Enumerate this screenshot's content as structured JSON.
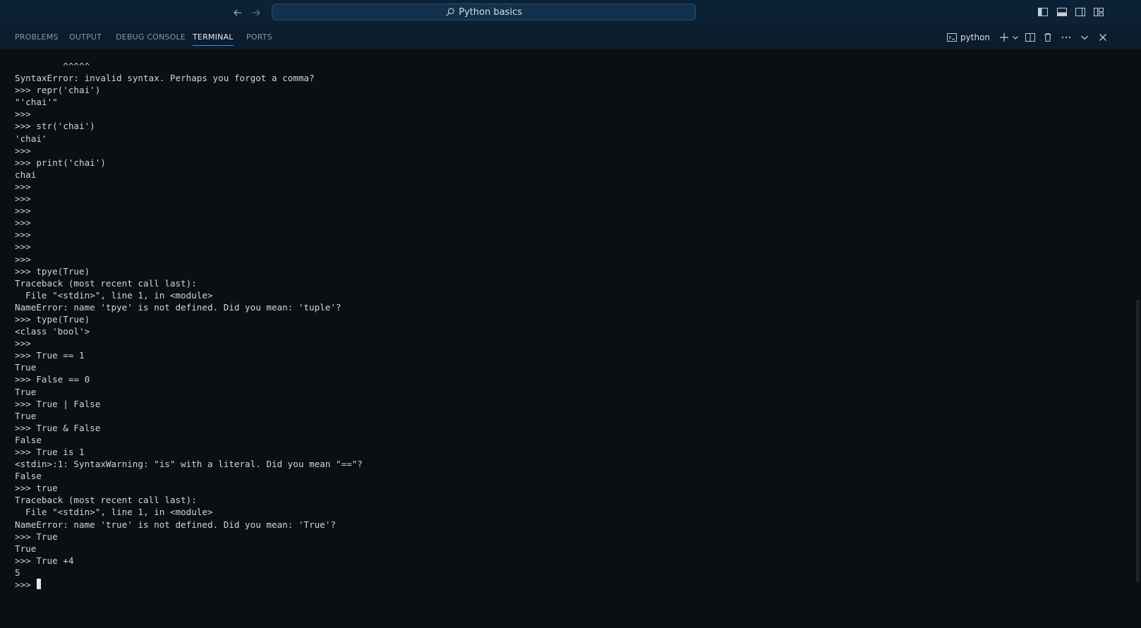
{
  "titlebar": {
    "search_label": "Python basics",
    "icons": [
      "arrow-left-icon",
      "arrow-right-icon",
      "search-icon",
      "toggle-primary-sidebar-icon",
      "toggle-panel-icon",
      "toggle-secondary-sidebar-icon",
      "customize-layout-icon"
    ]
  },
  "panel": {
    "tabs": [
      {
        "label": "PROBLEMS"
      },
      {
        "label": "OUTPUT"
      },
      {
        "label": "DEBUG CONSOLE"
      },
      {
        "label": "TERMINAL",
        "active": true
      },
      {
        "label": "PORTS"
      }
    ],
    "terminal_name": "python",
    "action_icons": [
      "terminal-icon",
      "plus-icon",
      "chevron-down-icon",
      "split-terminal-icon",
      "trash-icon",
      "more-icon",
      "maximize-chevron-icon",
      "close-icon"
    ]
  },
  "terminal": {
    "lines": [
      "         ^^^^^",
      "SyntaxError: invalid syntax. Perhaps you forgot a comma?",
      ">>> repr('chai')",
      "\"'chai'\"",
      ">>>",
      ">>> str('chai')",
      "'chai'",
      ">>>",
      ">>> print('chai')",
      "chai",
      ">>>",
      ">>>",
      ">>>",
      ">>>",
      ">>>",
      ">>>",
      ">>>",
      ">>> tpye(True)",
      "Traceback (most recent call last):",
      "  File \"<stdin>\", line 1, in <module>",
      "NameError: name 'tpye' is not defined. Did you mean: 'tuple'?",
      ">>> type(True)",
      "<class 'bool'>",
      ">>>",
      ">>> True == 1",
      "True",
      ">>> False == 0",
      "True",
      ">>> True | False",
      "True",
      ">>> True & False",
      "False",
      ">>> True is 1",
      "<stdin>:1: SyntaxWarning: \"is\" with a literal. Did you mean \"==\"?",
      "False",
      ">>> true",
      "Traceback (most recent call last):",
      "  File \"<stdin>\", line 1, in <module>",
      "NameError: name 'true' is not defined. Did you mean: 'True'?",
      ">>> True",
      "True",
      ">>> True +4",
      "5"
    ],
    "prompt": ">>> "
  },
  "colors": {
    "titlebar_bg": "#0b2236",
    "panel_header_bg": "#0b1c2c",
    "terminal_bg": "#0b0e12",
    "active_tab_underline": "#3794ff",
    "text": "#d4d4d4"
  }
}
